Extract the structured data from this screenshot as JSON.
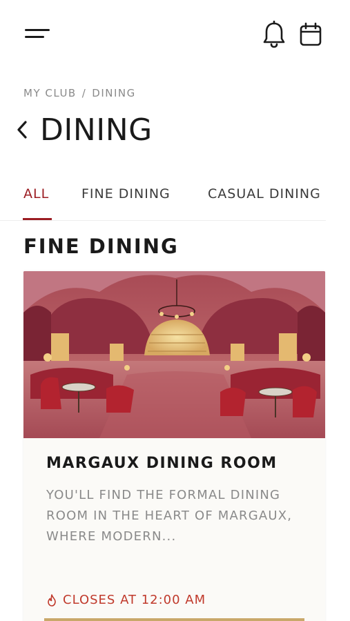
{
  "breadcrumb": {
    "parent": "My Club",
    "separator": "/",
    "current": "Dining"
  },
  "page": {
    "title": "DINING"
  },
  "tabs": [
    {
      "label": "All",
      "active": true
    },
    {
      "label": "Fine Dining",
      "active": false
    },
    {
      "label": "Casual Dining",
      "active": false
    }
  ],
  "section": {
    "title": "Fine Dining"
  },
  "card": {
    "title": "Margaux Dining Room",
    "description": "You'll find the formal dining room in the heart of Margaux, where modern...",
    "hours": "Closes at 12:00 AM"
  },
  "icons": {
    "menu": "menu-icon",
    "notifications": "bell-icon",
    "calendar": "calendar-icon",
    "back": "chevron-left-icon",
    "hours": "fire-icon"
  },
  "colors": {
    "accent": "#9b1c22",
    "hours_text": "#c0392b",
    "card_bar": "#c9a86a",
    "muted_text": "#8a8a8a"
  }
}
